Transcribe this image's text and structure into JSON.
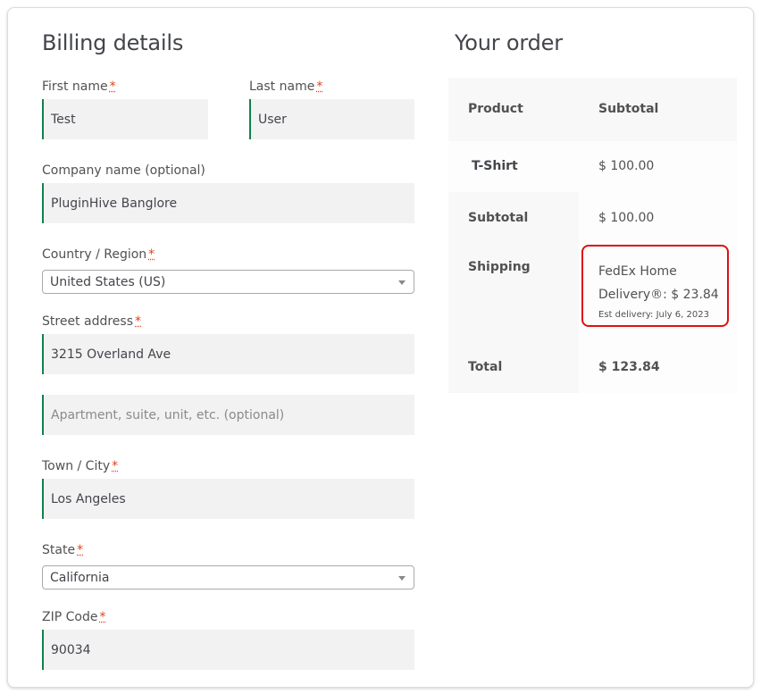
{
  "billing": {
    "title": "Billing details",
    "required_mark": "*",
    "first_name": {
      "label": "First name",
      "value": "Test"
    },
    "last_name": {
      "label": "Last name",
      "value": "User"
    },
    "company": {
      "label": "Company name (optional)",
      "value": "PluginHive Banglore"
    },
    "country": {
      "label": "Country / Region",
      "value": "United States (US)"
    },
    "street": {
      "label": "Street address",
      "value": "3215 Overland Ave"
    },
    "apartment": {
      "placeholder": "Apartment, suite, unit, etc. (optional)"
    },
    "city": {
      "label": "Town / City",
      "value": "Los Angeles"
    },
    "state": {
      "label": "State",
      "value": "California"
    },
    "zip": {
      "label": "ZIP Code",
      "value": "90034"
    }
  },
  "order": {
    "title": "Your order",
    "headers": {
      "product": "Product",
      "subtotal": "Subtotal"
    },
    "item": {
      "name": "T-Shirt",
      "price": "$ 100.00"
    },
    "subtotal": {
      "label": "Subtotal",
      "value": "$ 100.00"
    },
    "shipping": {
      "label": "Shipping",
      "method_line1": "FedEx Home",
      "method_line2": "Delivery®: $ 23.84",
      "est_delivery": "Est delivery: July 6, 2023"
    },
    "total": {
      "label": "Total",
      "value": "$ 123.84"
    }
  },
  "colors": {
    "accent_border": "#0f834d",
    "required": "#e2401c",
    "highlight": "#dd1111"
  }
}
